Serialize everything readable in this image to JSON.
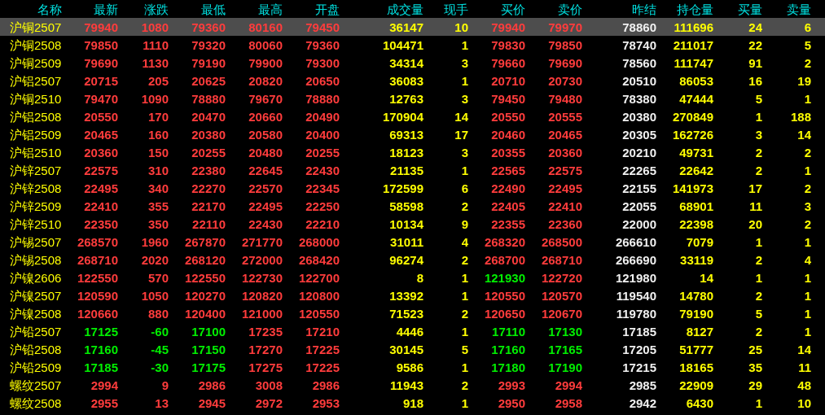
{
  "columns": [
    {
      "label": "名称",
      "kind": "name"
    },
    {
      "label": "最新",
      "kind": "price"
    },
    {
      "label": "涨跌",
      "kind": "price"
    },
    {
      "label": "最低",
      "kind": "price"
    },
    {
      "label": "最高",
      "kind": "price"
    },
    {
      "label": "开盘",
      "kind": "price"
    },
    {
      "label": "成交量",
      "kind": "volume"
    },
    {
      "label": "现手",
      "kind": "volume"
    },
    {
      "label": "买价",
      "kind": "price"
    },
    {
      "label": "卖价",
      "kind": "price"
    },
    {
      "label": "昨结",
      "kind": "reference"
    },
    {
      "label": "持仓量",
      "kind": "volume"
    },
    {
      "label": "买量",
      "kind": "volume"
    },
    {
      "label": "卖量",
      "kind": "volume"
    }
  ],
  "rows": [
    {
      "selected": true,
      "cells": [
        {
          "text": "沪铜2507"
        },
        {
          "text": "79940",
          "color": "#ff3c3c"
        },
        {
          "text": "1080",
          "color": "#ff3c3c"
        },
        {
          "text": "79360",
          "color": "#ff3c3c"
        },
        {
          "text": "80160",
          "color": "#ff3c3c"
        },
        {
          "text": "79450",
          "color": "#ff3c3c"
        },
        {
          "text": "36147"
        },
        {
          "text": "10"
        },
        {
          "text": "79940",
          "color": "#ff3c3c"
        },
        {
          "text": "79970",
          "color": "#ff3c3c"
        },
        {
          "text": "78860"
        },
        {
          "text": "111696"
        },
        {
          "text": "24"
        },
        {
          "text": "6"
        }
      ]
    },
    {
      "selected": false,
      "cells": [
        {
          "text": "沪铜2508"
        },
        {
          "text": "79850",
          "color": "#ff3c3c"
        },
        {
          "text": "1110",
          "color": "#ff3c3c"
        },
        {
          "text": "79320",
          "color": "#ff3c3c"
        },
        {
          "text": "80060",
          "color": "#ff3c3c"
        },
        {
          "text": "79360",
          "color": "#ff3c3c"
        },
        {
          "text": "104471"
        },
        {
          "text": "1"
        },
        {
          "text": "79830",
          "color": "#ff3c3c"
        },
        {
          "text": "79850",
          "color": "#ff3c3c"
        },
        {
          "text": "78740"
        },
        {
          "text": "211017"
        },
        {
          "text": "22"
        },
        {
          "text": "5"
        }
      ]
    },
    {
      "selected": false,
      "cells": [
        {
          "text": "沪铜2509"
        },
        {
          "text": "79690",
          "color": "#ff3c3c"
        },
        {
          "text": "1130",
          "color": "#ff3c3c"
        },
        {
          "text": "79190",
          "color": "#ff3c3c"
        },
        {
          "text": "79900",
          "color": "#ff3c3c"
        },
        {
          "text": "79300",
          "color": "#ff3c3c"
        },
        {
          "text": "34314"
        },
        {
          "text": "3"
        },
        {
          "text": "79660",
          "color": "#ff3c3c"
        },
        {
          "text": "79690",
          "color": "#ff3c3c"
        },
        {
          "text": "78560"
        },
        {
          "text": "111747"
        },
        {
          "text": "91"
        },
        {
          "text": "2"
        }
      ]
    },
    {
      "selected": false,
      "cells": [
        {
          "text": "沪铝2507"
        },
        {
          "text": "20715",
          "color": "#ff3c3c"
        },
        {
          "text": "205",
          "color": "#ff3c3c"
        },
        {
          "text": "20625",
          "color": "#ff3c3c"
        },
        {
          "text": "20820",
          "color": "#ff3c3c"
        },
        {
          "text": "20650",
          "color": "#ff3c3c"
        },
        {
          "text": "36083"
        },
        {
          "text": "1"
        },
        {
          "text": "20710",
          "color": "#ff3c3c"
        },
        {
          "text": "20730",
          "color": "#ff3c3c"
        },
        {
          "text": "20510"
        },
        {
          "text": "86053"
        },
        {
          "text": "16"
        },
        {
          "text": "19"
        }
      ]
    },
    {
      "selected": false,
      "cells": [
        {
          "text": "沪铜2510"
        },
        {
          "text": "79470",
          "color": "#ff3c3c"
        },
        {
          "text": "1090",
          "color": "#ff3c3c"
        },
        {
          "text": "78880",
          "color": "#ff3c3c"
        },
        {
          "text": "79670",
          "color": "#ff3c3c"
        },
        {
          "text": "78880",
          "color": "#ff3c3c"
        },
        {
          "text": "12763"
        },
        {
          "text": "3"
        },
        {
          "text": "79450",
          "color": "#ff3c3c"
        },
        {
          "text": "79480",
          "color": "#ff3c3c"
        },
        {
          "text": "78380"
        },
        {
          "text": "47444"
        },
        {
          "text": "5"
        },
        {
          "text": "1"
        }
      ]
    },
    {
      "selected": false,
      "cells": [
        {
          "text": "沪铝2508"
        },
        {
          "text": "20550",
          "color": "#ff3c3c"
        },
        {
          "text": "170",
          "color": "#ff3c3c"
        },
        {
          "text": "20470",
          "color": "#ff3c3c"
        },
        {
          "text": "20660",
          "color": "#ff3c3c"
        },
        {
          "text": "20490",
          "color": "#ff3c3c"
        },
        {
          "text": "170904"
        },
        {
          "text": "14"
        },
        {
          "text": "20550",
          "color": "#ff3c3c"
        },
        {
          "text": "20555",
          "color": "#ff3c3c"
        },
        {
          "text": "20380"
        },
        {
          "text": "270849"
        },
        {
          "text": "1"
        },
        {
          "text": "188"
        }
      ]
    },
    {
      "selected": false,
      "cells": [
        {
          "text": "沪铝2509"
        },
        {
          "text": "20465",
          "color": "#ff3c3c"
        },
        {
          "text": "160",
          "color": "#ff3c3c"
        },
        {
          "text": "20380",
          "color": "#ff3c3c"
        },
        {
          "text": "20580",
          "color": "#ff3c3c"
        },
        {
          "text": "20400",
          "color": "#ff3c3c"
        },
        {
          "text": "69313"
        },
        {
          "text": "17"
        },
        {
          "text": "20460",
          "color": "#ff3c3c"
        },
        {
          "text": "20465",
          "color": "#ff3c3c"
        },
        {
          "text": "20305"
        },
        {
          "text": "162726"
        },
        {
          "text": "3"
        },
        {
          "text": "14"
        }
      ]
    },
    {
      "selected": false,
      "cells": [
        {
          "text": "沪铝2510"
        },
        {
          "text": "20360",
          "color": "#ff3c3c"
        },
        {
          "text": "150",
          "color": "#ff3c3c"
        },
        {
          "text": "20255",
          "color": "#ff3c3c"
        },
        {
          "text": "20480",
          "color": "#ff3c3c"
        },
        {
          "text": "20255",
          "color": "#ff3c3c"
        },
        {
          "text": "18123"
        },
        {
          "text": "3"
        },
        {
          "text": "20355",
          "color": "#ff3c3c"
        },
        {
          "text": "20360",
          "color": "#ff3c3c"
        },
        {
          "text": "20210"
        },
        {
          "text": "49731"
        },
        {
          "text": "2"
        },
        {
          "text": "2"
        }
      ]
    },
    {
      "selected": false,
      "cells": [
        {
          "text": "沪锌2507"
        },
        {
          "text": "22575",
          "color": "#ff3c3c"
        },
        {
          "text": "310",
          "color": "#ff3c3c"
        },
        {
          "text": "22380",
          "color": "#ff3c3c"
        },
        {
          "text": "22645",
          "color": "#ff3c3c"
        },
        {
          "text": "22430",
          "color": "#ff3c3c"
        },
        {
          "text": "21135"
        },
        {
          "text": "1"
        },
        {
          "text": "22565",
          "color": "#ff3c3c"
        },
        {
          "text": "22575",
          "color": "#ff3c3c"
        },
        {
          "text": "22265"
        },
        {
          "text": "22642"
        },
        {
          "text": "2"
        },
        {
          "text": "1"
        }
      ]
    },
    {
      "selected": false,
      "cells": [
        {
          "text": "沪锌2508"
        },
        {
          "text": "22495",
          "color": "#ff3c3c"
        },
        {
          "text": "340",
          "color": "#ff3c3c"
        },
        {
          "text": "22270",
          "color": "#ff3c3c"
        },
        {
          "text": "22570",
          "color": "#ff3c3c"
        },
        {
          "text": "22345",
          "color": "#ff3c3c"
        },
        {
          "text": "172599"
        },
        {
          "text": "6"
        },
        {
          "text": "22490",
          "color": "#ff3c3c"
        },
        {
          "text": "22495",
          "color": "#ff3c3c"
        },
        {
          "text": "22155"
        },
        {
          "text": "141973"
        },
        {
          "text": "17"
        },
        {
          "text": "2"
        }
      ]
    },
    {
      "selected": false,
      "cells": [
        {
          "text": "沪锌2509"
        },
        {
          "text": "22410",
          "color": "#ff3c3c"
        },
        {
          "text": "355",
          "color": "#ff3c3c"
        },
        {
          "text": "22170",
          "color": "#ff3c3c"
        },
        {
          "text": "22495",
          "color": "#ff3c3c"
        },
        {
          "text": "22250",
          "color": "#ff3c3c"
        },
        {
          "text": "58598"
        },
        {
          "text": "2"
        },
        {
          "text": "22405",
          "color": "#ff3c3c"
        },
        {
          "text": "22410",
          "color": "#ff3c3c"
        },
        {
          "text": "22055"
        },
        {
          "text": "68901"
        },
        {
          "text": "11"
        },
        {
          "text": "3"
        }
      ]
    },
    {
      "selected": false,
      "cells": [
        {
          "text": "沪锌2510"
        },
        {
          "text": "22350",
          "color": "#ff3c3c"
        },
        {
          "text": "350",
          "color": "#ff3c3c"
        },
        {
          "text": "22110",
          "color": "#ff3c3c"
        },
        {
          "text": "22430",
          "color": "#ff3c3c"
        },
        {
          "text": "22210",
          "color": "#ff3c3c"
        },
        {
          "text": "10134"
        },
        {
          "text": "9"
        },
        {
          "text": "22355",
          "color": "#ff3c3c"
        },
        {
          "text": "22360",
          "color": "#ff3c3c"
        },
        {
          "text": "22000"
        },
        {
          "text": "22398"
        },
        {
          "text": "20"
        },
        {
          "text": "2"
        }
      ]
    },
    {
      "selected": false,
      "cells": [
        {
          "text": "沪锡2507"
        },
        {
          "text": "268570",
          "color": "#ff3c3c"
        },
        {
          "text": "1960",
          "color": "#ff3c3c"
        },
        {
          "text": "267870",
          "color": "#ff3c3c"
        },
        {
          "text": "271770",
          "color": "#ff3c3c"
        },
        {
          "text": "268000",
          "color": "#ff3c3c"
        },
        {
          "text": "31011"
        },
        {
          "text": "4"
        },
        {
          "text": "268320",
          "color": "#ff3c3c"
        },
        {
          "text": "268500",
          "color": "#ff3c3c"
        },
        {
          "text": "266610"
        },
        {
          "text": "7079"
        },
        {
          "text": "1"
        },
        {
          "text": "1"
        }
      ]
    },
    {
      "selected": false,
      "cells": [
        {
          "text": "沪锡2508"
        },
        {
          "text": "268710",
          "color": "#ff3c3c"
        },
        {
          "text": "2020",
          "color": "#ff3c3c"
        },
        {
          "text": "268120",
          "color": "#ff3c3c"
        },
        {
          "text": "272000",
          "color": "#ff3c3c"
        },
        {
          "text": "268420",
          "color": "#ff3c3c"
        },
        {
          "text": "96274"
        },
        {
          "text": "2"
        },
        {
          "text": "268700",
          "color": "#ff3c3c"
        },
        {
          "text": "268710",
          "color": "#ff3c3c"
        },
        {
          "text": "266690"
        },
        {
          "text": "33119"
        },
        {
          "text": "2"
        },
        {
          "text": "4"
        }
      ]
    },
    {
      "selected": false,
      "cells": [
        {
          "text": "沪镍2606"
        },
        {
          "text": "122550",
          "color": "#ff3c3c"
        },
        {
          "text": "570",
          "color": "#ff3c3c"
        },
        {
          "text": "122550",
          "color": "#ff3c3c"
        },
        {
          "text": "122730",
          "color": "#ff3c3c"
        },
        {
          "text": "122700",
          "color": "#ff3c3c"
        },
        {
          "text": "8"
        },
        {
          "text": "1"
        },
        {
          "text": "121930",
          "color": "#00f000"
        },
        {
          "text": "122720",
          "color": "#ff3c3c"
        },
        {
          "text": "121980"
        },
        {
          "text": "14"
        },
        {
          "text": "1"
        },
        {
          "text": "1"
        }
      ]
    },
    {
      "selected": false,
      "cells": [
        {
          "text": "沪镍2507"
        },
        {
          "text": "120590",
          "color": "#ff3c3c"
        },
        {
          "text": "1050",
          "color": "#ff3c3c"
        },
        {
          "text": "120270",
          "color": "#ff3c3c"
        },
        {
          "text": "120820",
          "color": "#ff3c3c"
        },
        {
          "text": "120800",
          "color": "#ff3c3c"
        },
        {
          "text": "13392"
        },
        {
          "text": "1"
        },
        {
          "text": "120550",
          "color": "#ff3c3c"
        },
        {
          "text": "120570",
          "color": "#ff3c3c"
        },
        {
          "text": "119540"
        },
        {
          "text": "14780"
        },
        {
          "text": "2"
        },
        {
          "text": "1"
        }
      ]
    },
    {
      "selected": false,
      "cells": [
        {
          "text": "沪镍2508"
        },
        {
          "text": "120660",
          "color": "#ff3c3c"
        },
        {
          "text": "880",
          "color": "#ff3c3c"
        },
        {
          "text": "120400",
          "color": "#ff3c3c"
        },
        {
          "text": "121000",
          "color": "#ff3c3c"
        },
        {
          "text": "120550",
          "color": "#ff3c3c"
        },
        {
          "text": "71523"
        },
        {
          "text": "2"
        },
        {
          "text": "120650",
          "color": "#ff3c3c"
        },
        {
          "text": "120670",
          "color": "#ff3c3c"
        },
        {
          "text": "119780"
        },
        {
          "text": "79190"
        },
        {
          "text": "5"
        },
        {
          "text": "1"
        }
      ]
    },
    {
      "selected": false,
      "cells": [
        {
          "text": "沪铅2507"
        },
        {
          "text": "17125",
          "color": "#00f000"
        },
        {
          "text": "-60",
          "color": "#00f000"
        },
        {
          "text": "17100",
          "color": "#00f000"
        },
        {
          "text": "17235",
          "color": "#ff3c3c"
        },
        {
          "text": "17210",
          "color": "#ff3c3c"
        },
        {
          "text": "4446"
        },
        {
          "text": "1"
        },
        {
          "text": "17110",
          "color": "#00f000"
        },
        {
          "text": "17130",
          "color": "#00f000"
        },
        {
          "text": "17185"
        },
        {
          "text": "8127"
        },
        {
          "text": "2"
        },
        {
          "text": "1"
        }
      ]
    },
    {
      "selected": false,
      "cells": [
        {
          "text": "沪铅2508"
        },
        {
          "text": "17160",
          "color": "#00f000"
        },
        {
          "text": "-45",
          "color": "#00f000"
        },
        {
          "text": "17150",
          "color": "#00f000"
        },
        {
          "text": "17270",
          "color": "#ff3c3c"
        },
        {
          "text": "17225",
          "color": "#ff3c3c"
        },
        {
          "text": "30145"
        },
        {
          "text": "5"
        },
        {
          "text": "17160",
          "color": "#00f000"
        },
        {
          "text": "17165",
          "color": "#00f000"
        },
        {
          "text": "17205"
        },
        {
          "text": "51777"
        },
        {
          "text": "25"
        },
        {
          "text": "14"
        }
      ]
    },
    {
      "selected": false,
      "cells": [
        {
          "text": "沪铅2509"
        },
        {
          "text": "17185",
          "color": "#00f000"
        },
        {
          "text": "-30",
          "color": "#00f000"
        },
        {
          "text": "17175",
          "color": "#00f000"
        },
        {
          "text": "17275",
          "color": "#ff3c3c"
        },
        {
          "text": "17225",
          "color": "#ff3c3c"
        },
        {
          "text": "9586"
        },
        {
          "text": "1"
        },
        {
          "text": "17180",
          "color": "#00f000"
        },
        {
          "text": "17190",
          "color": "#00f000"
        },
        {
          "text": "17215"
        },
        {
          "text": "18165"
        },
        {
          "text": "35"
        },
        {
          "text": "11"
        }
      ]
    },
    {
      "selected": false,
      "cells": [
        {
          "text": "螺纹2507"
        },
        {
          "text": "2994",
          "color": "#ff3c3c"
        },
        {
          "text": "9",
          "color": "#ff3c3c"
        },
        {
          "text": "2986",
          "color": "#ff3c3c"
        },
        {
          "text": "3008",
          "color": "#ff3c3c"
        },
        {
          "text": "2986",
          "color": "#ff3c3c"
        },
        {
          "text": "11943"
        },
        {
          "text": "2"
        },
        {
          "text": "2993",
          "color": "#ff3c3c"
        },
        {
          "text": "2994",
          "color": "#ff3c3c"
        },
        {
          "text": "2985"
        },
        {
          "text": "22909"
        },
        {
          "text": "29"
        },
        {
          "text": "48"
        }
      ]
    },
    {
      "selected": false,
      "cells": [
        {
          "text": "螺纹2508"
        },
        {
          "text": "2955",
          "color": "#ff3c3c"
        },
        {
          "text": "13",
          "color": "#ff3c3c"
        },
        {
          "text": "2945",
          "color": "#ff3c3c"
        },
        {
          "text": "2972",
          "color": "#ff3c3c"
        },
        {
          "text": "2953",
          "color": "#ff3c3c"
        },
        {
          "text": "918"
        },
        {
          "text": "1"
        },
        {
          "text": "2950",
          "color": "#ff3c3c"
        },
        {
          "text": "2958",
          "color": "#ff3c3c"
        },
        {
          "text": "2942"
        },
        {
          "text": "6430"
        },
        {
          "text": "1"
        },
        {
          "text": "10"
        }
      ]
    }
  ]
}
